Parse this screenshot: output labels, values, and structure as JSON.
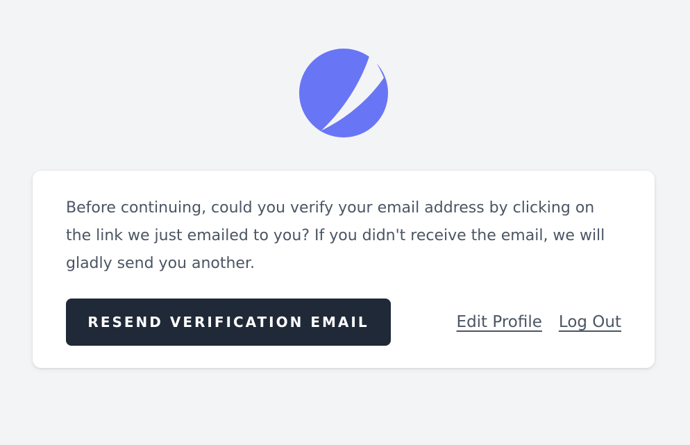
{
  "logo": {
    "name": "app-logo",
    "colors": {
      "primary": "#6875f5",
      "background": "#f3f4f6"
    }
  },
  "verification_card": {
    "message": "Before continuing, could you verify your email address by clicking on the link we just emailed to you? If you didn't receive the email, we will gladly send you another.",
    "resend_button_label": "RESEND VERIFICATION EMAIL",
    "edit_profile_label": "Edit Profile",
    "log_out_label": "Log Out"
  },
  "colors": {
    "page_background": "#f3f4f6",
    "card_background": "#ffffff",
    "primary_text": "#4b5563",
    "button_background": "#1f2937",
    "button_text": "#ffffff"
  }
}
